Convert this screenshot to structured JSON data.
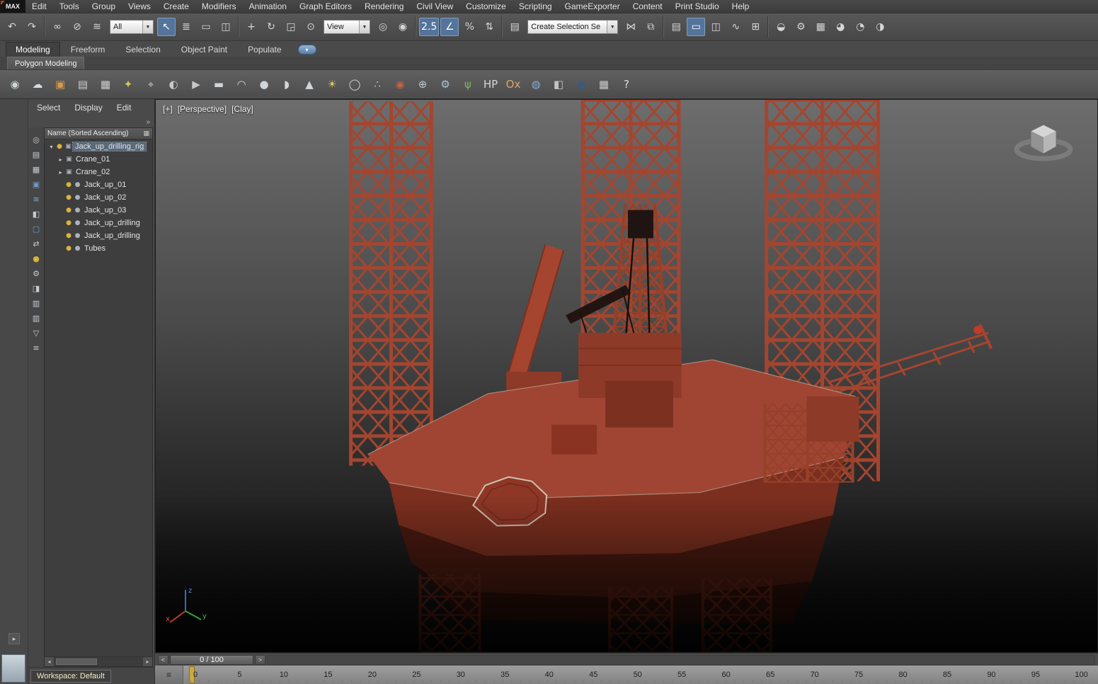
{
  "app": {
    "logo": "MAX"
  },
  "menubar": {
    "items": [
      "Edit",
      "Tools",
      "Group",
      "Views",
      "Create",
      "Modifiers",
      "Animation",
      "Graph Editors",
      "Rendering",
      "Civil View",
      "Customize",
      "Scripting",
      "GameExporter",
      "Content",
      "Print Studio",
      "Help"
    ]
  },
  "toolbar": {
    "history_icons": [
      {
        "name": "undo-icon",
        "glyph": "↶"
      },
      {
        "name": "redo-icon",
        "glyph": "↷"
      }
    ],
    "link_icons": [
      {
        "name": "select-and-link-icon",
        "glyph": "∞"
      },
      {
        "name": "unlink-selection-icon",
        "glyph": "⊘"
      },
      {
        "name": "bind-to-space-warp-icon",
        "glyph": "≋"
      }
    ],
    "selection_filter": {
      "value": "All"
    },
    "select_icons": [
      {
        "name": "select-object-icon",
        "glyph": "↖",
        "active": true
      },
      {
        "name": "select-by-name-icon",
        "glyph": "≣"
      },
      {
        "name": "selection-region-icon",
        "glyph": "▭"
      },
      {
        "name": "window-crossing-icon",
        "glyph": "◫"
      }
    ],
    "transform_icons": [
      {
        "name": "select-and-move-icon",
        "glyph": "+"
      },
      {
        "name": "select-and-rotate-icon",
        "glyph": "↻"
      },
      {
        "name": "select-and-scale-icon",
        "glyph": "◲"
      },
      {
        "name": "select-and-place-icon",
        "glyph": "⊙"
      }
    ],
    "coord_system": {
      "value": "View"
    },
    "center_icons": [
      {
        "name": "use-pivot-center-icon",
        "glyph": "◎"
      },
      {
        "name": "select-and-manipulate-icon",
        "glyph": "◉"
      }
    ],
    "snap_icons": [
      {
        "name": "snaps-toggle-icon",
        "glyph": "2.5",
        "active": true
      },
      {
        "name": "angle-snap-icon",
        "glyph": "∠",
        "active": true
      },
      {
        "name": "percent-snap-icon",
        "glyph": "%"
      },
      {
        "name": "spinner-snap-icon",
        "glyph": "⇅"
      }
    ],
    "sets_icons": [
      {
        "name": "edit-named-selection-sets-icon",
        "glyph": "▤"
      }
    ],
    "named_sets": {
      "value": "Create Selection Se"
    },
    "mirror_align_icons": [
      {
        "name": "mirror-icon",
        "glyph": "⋈"
      },
      {
        "name": "align-icon",
        "glyph": "⧉"
      }
    ],
    "manager_icons": [
      {
        "name": "toggle-layer-explorer-icon",
        "glyph": "▤"
      },
      {
        "name": "toggle-ribbon-icon",
        "glyph": "▭",
        "active": true
      },
      {
        "name": "toggle-scene-explorer-icon",
        "glyph": "◫"
      },
      {
        "name": "curve-editor-icon",
        "glyph": "∿"
      },
      {
        "name": "schematic-view-icon",
        "glyph": "⊞"
      }
    ],
    "render_icons": [
      {
        "name": "material-editor-icon",
        "glyph": "◒"
      },
      {
        "name": "render-setup-icon",
        "glyph": "⚙"
      },
      {
        "name": "rendered-frame-window-icon",
        "glyph": "▦"
      },
      {
        "name": "render-production-icon",
        "glyph": "◕"
      },
      {
        "name": "render-iterative-icon",
        "glyph": "◔"
      },
      {
        "name": "open-activeshade-icon",
        "glyph": "◑"
      }
    ]
  },
  "ribbon": {
    "tabs": [
      {
        "name": "tab-modeling",
        "label": "Modeling",
        "active": true
      },
      {
        "name": "tab-freeform",
        "label": "Freeform"
      },
      {
        "name": "tab-selection",
        "label": "Selection"
      },
      {
        "name": "tab-object-paint",
        "label": "Object Paint"
      },
      {
        "name": "tab-populate",
        "label": "Populate"
      }
    ],
    "subtab": "Polygon Modeling",
    "tool_icons": [
      {
        "name": "select-cursor-icon",
        "glyph": "◉",
        "color": "#cfd6da"
      },
      {
        "name": "cloud-icon",
        "glyph": "☁",
        "color": "#d4dde2"
      },
      {
        "name": "canvas-icon",
        "glyph": "▣",
        "color": "#d89a4a"
      },
      {
        "name": "notes-icon",
        "glyph": "▤",
        "color": "#cfcfcf"
      },
      {
        "name": "spreadsheet-icon",
        "glyph": "▦",
        "color": "#cfcfcf"
      },
      {
        "name": "key-light-icon",
        "glyph": "✦",
        "color": "#dcc455"
      },
      {
        "name": "camera-icon",
        "glyph": "⌖",
        "color": "#c8c8c8"
      },
      {
        "name": "shading-icon",
        "glyph": "◐",
        "color": "#c8c8c8"
      },
      {
        "name": "clip-icon",
        "glyph": "▶",
        "color": "#c8c8c8"
      },
      {
        "name": "plane-primitive-icon",
        "glyph": "▬",
        "color": "#d0d5d9"
      },
      {
        "name": "dome-primitive-icon",
        "glyph": "◠",
        "color": "#d0d5d9"
      },
      {
        "name": "sphere-primitive-icon",
        "glyph": "●",
        "color": "#d0d5d9"
      },
      {
        "name": "shell-primitive-icon",
        "glyph": "◗",
        "color": "#d0d5d9"
      },
      {
        "name": "cone-primitive-icon",
        "glyph": "▲",
        "color": "#d0d5d9"
      },
      {
        "name": "sun-icon",
        "glyph": "☀",
        "color": "#e4cc5e"
      },
      {
        "name": "geosphere-primitive-icon",
        "glyph": "◯",
        "color": "#d0d5d9"
      },
      {
        "name": "particles-icon",
        "glyph": "∴",
        "color": "#a9c2d2"
      },
      {
        "name": "metaball-icon",
        "glyph": "◉",
        "color": "#c4604a"
      },
      {
        "name": "atom-icon",
        "glyph": "⊕",
        "color": "#b8c8d4"
      },
      {
        "name": "gear-icon",
        "glyph": "⚙",
        "color": "#a9c6dc"
      },
      {
        "name": "foliage-icon",
        "glyph": "ψ",
        "color": "#86b45e"
      },
      {
        "name": "hp-icon",
        "glyph": "HP",
        "color": "#d6d6d6"
      },
      {
        "name": "ox-icon",
        "glyph": "Ox",
        "color": "#d8a868"
      },
      {
        "name": "water-sphere-icon",
        "glyph": "◍",
        "color": "#86aed6"
      },
      {
        "name": "adjust-icon",
        "glyph": "◧",
        "color": "#c4c4c4"
      },
      {
        "name": "dark-sphere-icon",
        "glyph": "●",
        "color": "#3d5a74"
      },
      {
        "name": "building-icon",
        "glyph": "▦",
        "color": "#cccccc"
      },
      {
        "name": "help-icon",
        "glyph": "?",
        "color": "#e0e0e0"
      }
    ]
  },
  "explorer": {
    "menu": [
      {
        "name": "explorer-menu-select",
        "label": "Select"
      },
      {
        "name": "explorer-menu-display",
        "label": "Display"
      },
      {
        "name": "explorer-menu-edit",
        "label": "Edit"
      }
    ],
    "overflow_glyph": "»",
    "header": "Name (Sorted Ascending)",
    "side_icons": [
      {
        "name": "pick-object-icon",
        "glyph": "◎"
      },
      {
        "name": "hierarchy-icon",
        "glyph": "▤"
      },
      {
        "name": "display-grid-icon",
        "glyph": "▦"
      },
      {
        "name": "container-icon",
        "glyph": "▣",
        "color": "#6f9cc6"
      },
      {
        "name": "water-icon",
        "glyph": "≋",
        "color": "#7fa8c8"
      },
      {
        "name": "render-flag-icon",
        "glyph": "◧"
      },
      {
        "name": "frame-icon",
        "glyph": "▢",
        "color": "#6f9cc6"
      },
      {
        "name": "link-icon",
        "glyph": "⇄"
      },
      {
        "name": "bulb-icon",
        "glyph": "●",
        "color": "#d9b23a"
      },
      {
        "name": "gear-icon",
        "glyph": "⚙"
      },
      {
        "name": "cube-icon",
        "glyph": "◨"
      },
      {
        "name": "sheet-icon",
        "glyph": "▥"
      },
      {
        "name": "sheet-alt-icon",
        "glyph": "▥"
      },
      {
        "name": "funnel-icon",
        "glyph": "▽"
      },
      {
        "name": "list-icon",
        "glyph": "≡"
      }
    ],
    "items": [
      {
        "name": "tree-item-jack-up-drilling-rig",
        "depth": 0,
        "expander": "▾",
        "bulb": "●",
        "geo": "▣",
        "label": "Jack_up_drilling_rig",
        "selected": true
      },
      {
        "name": "tree-item-crane-01",
        "depth": 1,
        "expander": "▸",
        "bulb": "",
        "geo": "▣",
        "label": "Crane_01"
      },
      {
        "name": "tree-item-crane-02",
        "depth": 1,
        "expander": "▸",
        "bulb": "",
        "geo": "▣",
        "label": "Crane_02"
      },
      {
        "name": "tree-item-jack-up-01",
        "depth": 1,
        "expander": "",
        "bulb": "●",
        "geo": "●",
        "label": "Jack_up_01"
      },
      {
        "name": "tree-item-jack-up-02",
        "depth": 1,
        "expander": "",
        "bulb": "●",
        "geo": "●",
        "label": "Jack_up_02"
      },
      {
        "name": "tree-item-jack-up-03",
        "depth": 1,
        "expander": "",
        "bulb": "●",
        "geo": "●",
        "label": "Jack_up_03"
      },
      {
        "name": "tree-item-jack-up-drilling-a",
        "depth": 1,
        "expander": "",
        "bulb": "●",
        "geo": "●",
        "label": "Jack_up_drilling"
      },
      {
        "name": "tree-item-jack-up-drilling-b",
        "depth": 1,
        "expander": "",
        "bulb": "●",
        "geo": "●",
        "label": "Jack_up_drilling"
      },
      {
        "name": "tree-item-tubes",
        "depth": 1,
        "expander": "",
        "bulb": "●",
        "geo": "●",
        "label": "Tubes"
      }
    ]
  },
  "viewport": {
    "label_plus": "[+]",
    "label_view": "[Perspective]",
    "label_shading": "[Clay]",
    "axis_x": "x",
    "axis_y": "y",
    "axis_z": "z"
  },
  "timeline": {
    "prev": "<",
    "next": ">",
    "value": "0 / 100",
    "ticks": [
      "0",
      "5",
      "10",
      "15",
      "20",
      "25",
      "30",
      "35",
      "40",
      "45",
      "50",
      "55",
      "60",
      "65",
      "70",
      "75",
      "80",
      "85",
      "90",
      "95",
      "100"
    ]
  },
  "statusbar": {
    "workspace": "Workspace: Default"
  },
  "colors": {
    "chrome": "#4a4a4a",
    "active_blue": "#55749b",
    "rig_red": "#a5452f",
    "viewport_top": "#6d6d6d",
    "viewport_bottom": "#0a0a0a",
    "ruler_bg": "#8f8f8f",
    "frame_marker": "#cfa93c",
    "bulb_yellow": "#d9b23a"
  }
}
